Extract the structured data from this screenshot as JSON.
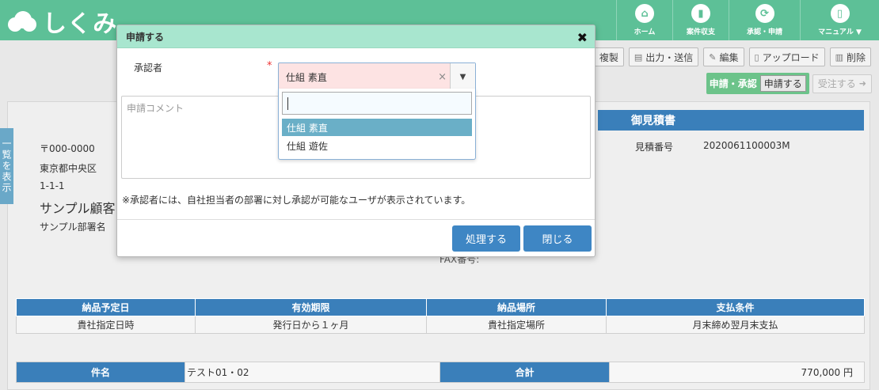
{
  "header": {
    "logo_text": "しくみ",
    "nav": [
      {
        "label": "ホーム",
        "icon": "home-icon"
      },
      {
        "label": "案件収支",
        "icon": "chart-icon"
      },
      {
        "label": "承認・申請",
        "icon": "cycle-icon"
      },
      {
        "label": "マニュアル ▼",
        "icon": "book-icon"
      }
    ]
  },
  "toolbar": {
    "copy": "複製",
    "output": "出力・送信",
    "edit": "編集",
    "upload": "アップロード",
    "delete": "削除"
  },
  "approval": {
    "group_label": "申請・承認",
    "apply": "申請する",
    "order": "受注する"
  },
  "side_tab": "一覧を表示",
  "document": {
    "title": "御見積書",
    "postal": "〒000-0000",
    "address1": "東京都中央区",
    "address2": "1-1-1",
    "customer": "サンプル顧客",
    "dept": "サンプル部署名",
    "estimate_label": "見積番号",
    "estimate_no": "2020061100003M",
    "fax_label": "FAX番号:",
    "info_headers": [
      "納品予定日",
      "有効期限",
      "納品場所",
      "支払条件"
    ],
    "info_values": [
      "貴社指定日時",
      "発行日から１ヶ月",
      "貴社指定場所",
      "月末締め翌月末支払"
    ],
    "subject_label": "件名",
    "subject_value": "テスト01・02",
    "total_label": "合計",
    "total_value": "770,000 円"
  },
  "modal": {
    "title": "申請する",
    "approver_label": "承認者",
    "required_mark": "*",
    "selected_value": "仕組 素直",
    "clear_mark": "×",
    "comment_placeholder": "申請コメント",
    "note": "※承認者には、自社担当者の部署に対し承認が可能なユーザが表示されています。",
    "submit": "処理する",
    "close": "閉じる",
    "options": [
      "仕組 素直",
      "仕組 遊佐"
    ]
  }
}
